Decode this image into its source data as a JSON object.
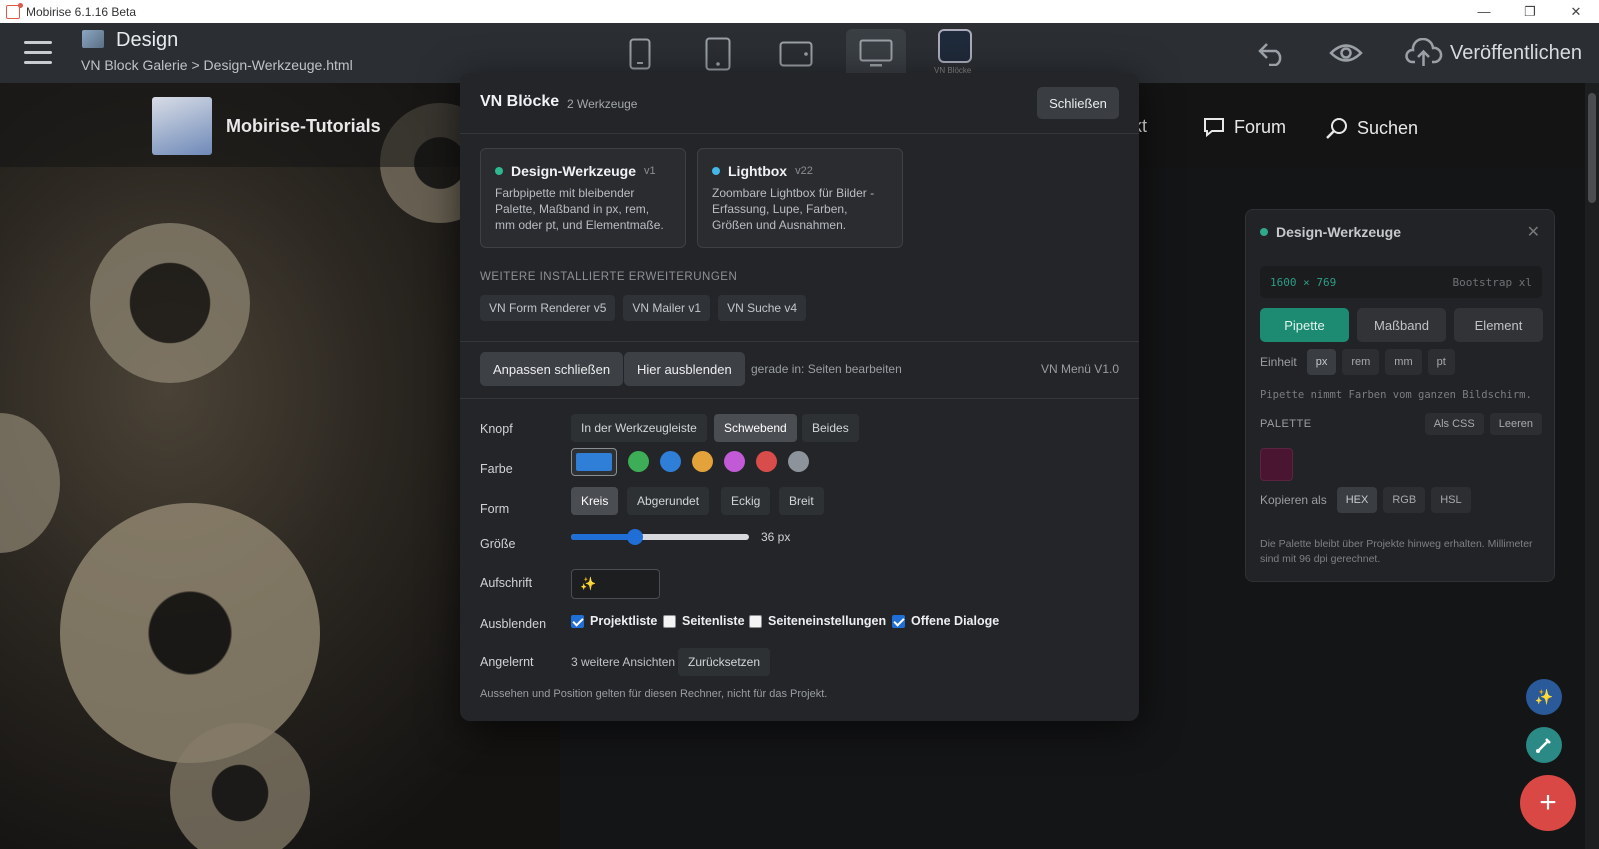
{
  "window": {
    "title": "Mobirise 6.1.16 Beta",
    "controls": [
      "minimize",
      "restore",
      "close"
    ]
  },
  "appbar": {
    "project_title": "Design",
    "path": "VN Block Galerie > Design-Werkzeuge.html",
    "devices": [
      "phone",
      "tablet-portrait",
      "tablet-landscape",
      "desktop"
    ],
    "active_device": "desktop",
    "vn_block_label": "VN Blöcke",
    "publish": "Veröffentlichen"
  },
  "site": {
    "name": "Mobirise-Tutorials",
    "links": [
      {
        "label": "kt",
        "icon": "partial-text"
      },
      {
        "label": "Forum",
        "icon": "chat-icon"
      },
      {
        "label": "Suchen",
        "icon": "search-icon"
      }
    ]
  },
  "dw_panel": {
    "title": "Design-Werkzeuge",
    "dimension": "1600 × 769",
    "breakpoint": "Bootstrap xl",
    "tools": [
      "Pipette",
      "Maßband",
      "Element"
    ],
    "active_tool": "Pipette",
    "unit_label": "Einheit",
    "units": [
      "px",
      "rem",
      "mm",
      "pt"
    ],
    "active_unit": "px",
    "hint": "Pipette nimmt Farben vom ganzen Bildschirm.",
    "palette_label": "PALETTE",
    "palette_actions": [
      "Als CSS",
      "Leeren"
    ],
    "palette_colors": [
      "#4a1530"
    ],
    "copy_label": "Kopieren als",
    "copy_formats": [
      "HEX",
      "RGB",
      "HSL"
    ],
    "active_format": "HEX",
    "footer": "Die Palette bleibt über Projekte hinweg erhalten. Millimeter sind mit 96 dpi gerechnet."
  },
  "modal": {
    "title": "VN Blöcke",
    "subtitle": "2 Werkzeuge",
    "close": "Schließen",
    "extensions": [
      {
        "name": "Design-Werkzeuge",
        "version": "v1",
        "dot": "#2fb88f",
        "desc": "Farbpipette mit bleibender Palette, Maßband in px, rem, mm oder pt, und Elementmaße."
      },
      {
        "name": "Lightbox",
        "version": "v22",
        "dot": "#45b6e8",
        "desc": "Zoombare Lightbox für Bilder - Erfassung, Lupe, Farben, Größen und Ausnahmen."
      }
    ],
    "more_label": "WEITERE INSTALLIERTE ERWEITERUNGEN",
    "more": [
      "VN Form Renderer v5",
      "VN Mailer v1",
      "VN Suche v4"
    ],
    "actions": {
      "close_customize": "Anpassen schließen",
      "hide_here": "Hier ausblenden",
      "context": "gerade in: Seiten bearbeiten",
      "version": "VN Menü V1.0"
    },
    "knopf": {
      "label": "Knopf",
      "options": [
        "In der Werkzeugleiste",
        "Schwebend",
        "Beides"
      ],
      "selected": "Schwebend"
    },
    "farbe": {
      "label": "Farbe",
      "selected": "#2f7fd8",
      "colors": [
        "#3dae57",
        "#2f7fd8",
        "#e4a23a",
        "#c25ad8",
        "#d94c4c",
        "#8c939b"
      ]
    },
    "form": {
      "label": "Form",
      "options": [
        "Kreis",
        "Abgerundet",
        "Eckig",
        "Breit"
      ],
      "selected": "Kreis"
    },
    "groesse": {
      "label": "Größe",
      "value": 36,
      "min": 16,
      "max": 72,
      "display": "36 px"
    },
    "aufschrift": {
      "label": "Aufschrift",
      "value": "✨"
    },
    "ausblenden": {
      "label": "Ausblenden",
      "items": [
        {
          "label": "Projektliste",
          "checked": true
        },
        {
          "label": "Seitenliste",
          "checked": false
        },
        {
          "label": "Seiteneinstellungen",
          "checked": false
        },
        {
          "label": "Offene Dialoge",
          "checked": true
        }
      ]
    },
    "angelernt": {
      "label": "Angelernt",
      "text": "3 weitere Ansichten",
      "reset": "Zurücksetzen"
    },
    "footnote": "Aussehen und Position gelten für diesen Rechner, nicht für das Projekt."
  }
}
